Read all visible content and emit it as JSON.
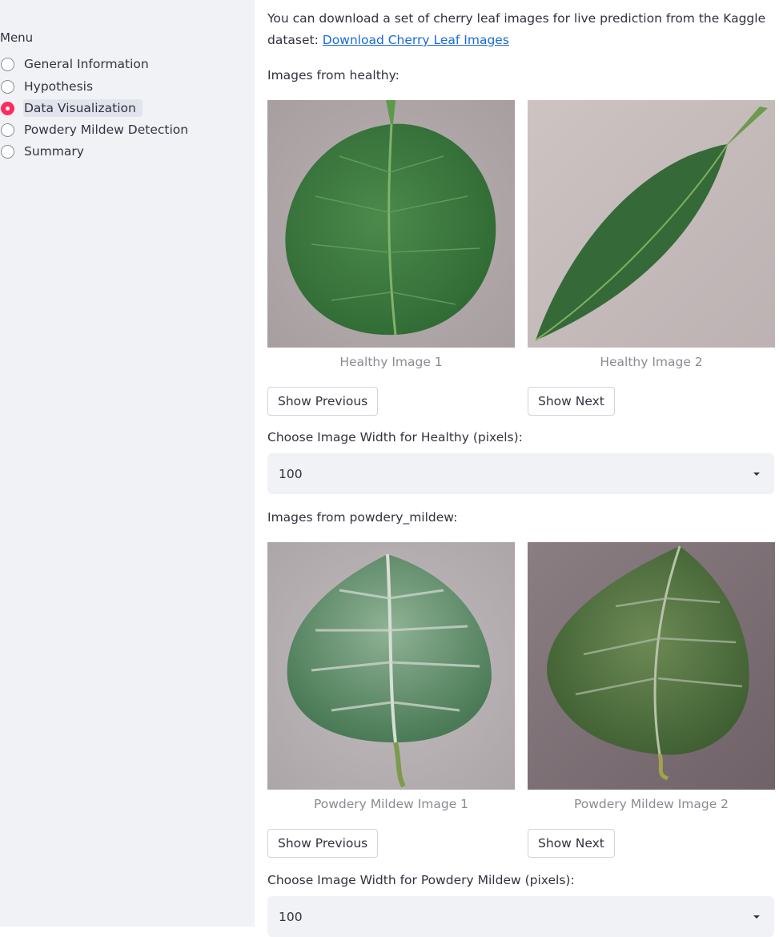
{
  "sidebar": {
    "menu_title": "Menu",
    "items": [
      {
        "label": "General Information",
        "selected": false
      },
      {
        "label": "Hypothesis",
        "selected": false
      },
      {
        "label": "Data Visualization",
        "selected": true
      },
      {
        "label": "Powdery Mildew Detection",
        "selected": false
      },
      {
        "label": "Summary",
        "selected": false
      }
    ]
  },
  "main": {
    "intro_text": "You can download a set of cherry leaf images for live prediction from the Kaggle",
    "intro_text_line2": "dataset: ",
    "download_link": "Download Cherry Leaf Images",
    "healthy": {
      "heading": "Images from healthy:",
      "captions": [
        "Healthy Image 1",
        "Healthy Image 2"
      ],
      "prev_button": "Show Previous",
      "next_button": "Show Next",
      "width_label": "Choose Image Width for Healthy (pixels):",
      "width_value": "100"
    },
    "mildew": {
      "heading": "Images from powdery_mildew:",
      "captions": [
        "Powdery Mildew Image 1",
        "Powdery Mildew Image 2"
      ],
      "prev_button": "Show Previous",
      "next_button": "Show Next",
      "width_label": "Choose Image Width for Powdery Mildew (pixels):",
      "width_value": "100"
    }
  },
  "colors": {
    "sidebar_bg": "#f0f2f6",
    "accent": "#ff2b5c",
    "link": "#1a6ad8",
    "text": "#31333f",
    "caption": "#8a8b91"
  }
}
